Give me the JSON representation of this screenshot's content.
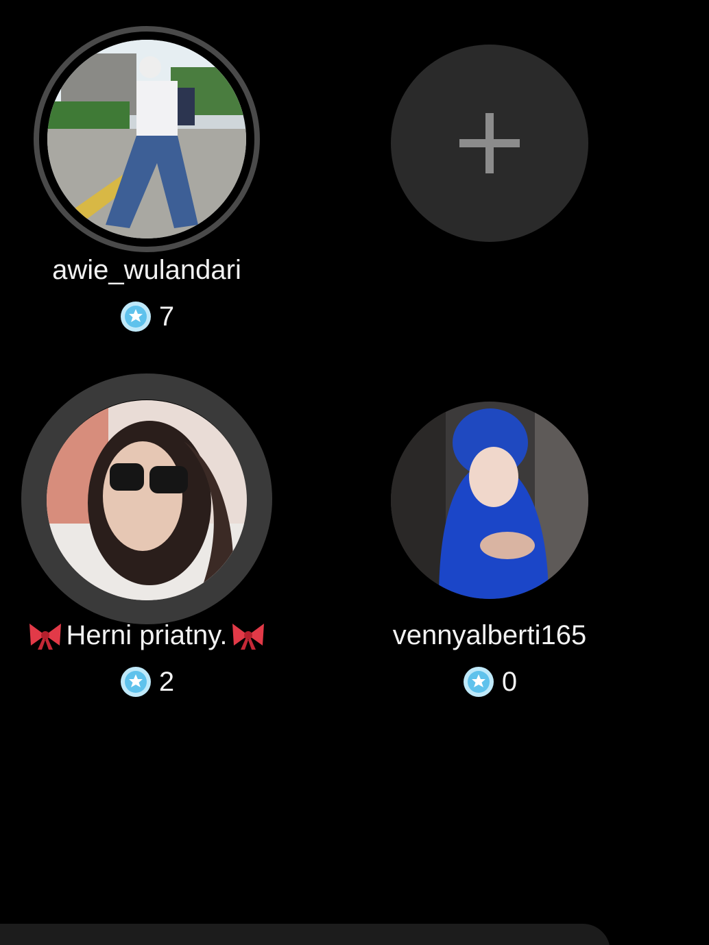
{
  "participants": [
    {
      "username": "awie_wulandari",
      "score": "7"
    },
    {
      "username": "Herni priatny.",
      "score": "2",
      "emoji_decoration": "ribbon-bow"
    },
    {
      "username": "vennyalberti165",
      "score": "0"
    }
  ],
  "add_slot": {
    "icon": "plus-icon"
  },
  "colors": {
    "background": "#000000",
    "add_button": "#2a2a2a",
    "badge": "#7fd0f0",
    "ring": "#555555"
  }
}
